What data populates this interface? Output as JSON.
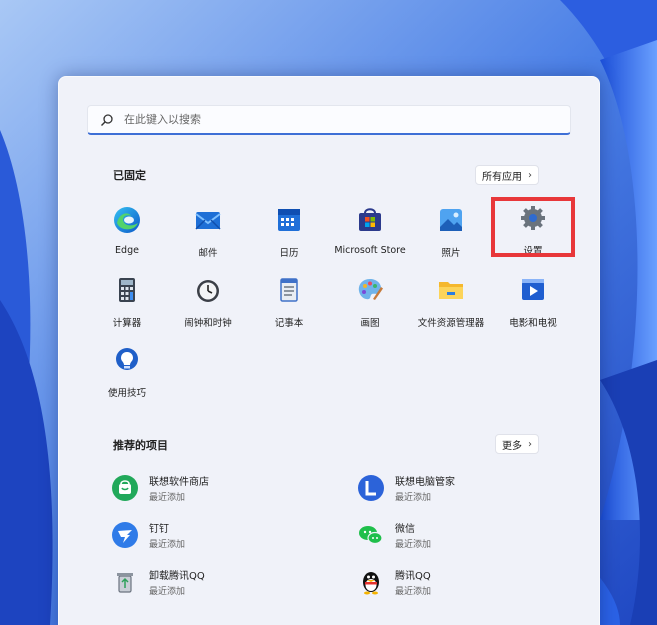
{
  "search": {
    "placeholder": "在此键入以搜索"
  },
  "pinned": {
    "title": "已固定",
    "all_apps": "所有应用",
    "apps": [
      {
        "label": "Edge"
      },
      {
        "label": "邮件"
      },
      {
        "label": "日历"
      },
      {
        "label": "Microsoft Store"
      },
      {
        "label": "照片"
      },
      {
        "label": "设置"
      },
      {
        "label": "计算器"
      },
      {
        "label": "闹钟和时钟"
      },
      {
        "label": "记事本"
      },
      {
        "label": "画图"
      },
      {
        "label": "文件资源管理器"
      },
      {
        "label": "电影和电视"
      },
      {
        "label": "使用技巧"
      }
    ]
  },
  "recommended": {
    "title": "推荐的项目",
    "more": "更多",
    "items": [
      {
        "name": "联想软件商店",
        "sub": "最近添加"
      },
      {
        "name": "联想电脑管家",
        "sub": "最近添加"
      },
      {
        "name": "钉钉",
        "sub": "最近添加"
      },
      {
        "name": "微信",
        "sub": "最近添加"
      },
      {
        "name": "卸载腾讯QQ",
        "sub": "最近添加"
      },
      {
        "name": "腾讯QQ",
        "sub": "最近添加"
      }
    ]
  },
  "colors": {
    "accent": "#3e6fd6",
    "highlight": "#e8373a"
  }
}
